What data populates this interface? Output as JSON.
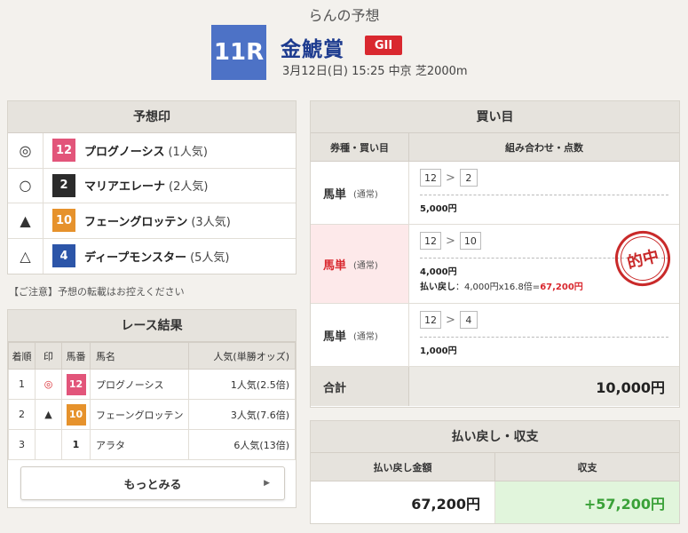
{
  "header": {
    "title": "らんの予想",
    "race_no": "11R",
    "race_name": "金鯱賞",
    "grade": "GII",
    "info": "3月12日(日) 15:25 中京 芝2000m"
  },
  "prediction": {
    "heading": "予想印",
    "items": [
      {
        "mark": "◎",
        "num": "12",
        "name": "プログノーシス",
        "pop": "(1人気)",
        "color": "#e2557a"
      },
      {
        "mark": "○",
        "num": "2",
        "name": "マリアエレーナ",
        "pop": "(2人気)",
        "color": "#2b2b2b"
      },
      {
        "mark": "▲",
        "num": "10",
        "name": "フェーングロッテン",
        "pop": "(3人気)",
        "color": "#e6922c"
      },
      {
        "mark": "△",
        "num": "4",
        "name": "ディープモンスター",
        "pop": "(5人気)",
        "color": "#2c55a8"
      }
    ],
    "note": "【ご注意】予想の転載はお控えください"
  },
  "result": {
    "heading": "レース結果",
    "columns": [
      "着順",
      "印",
      "馬番",
      "馬名",
      "人気(単勝オッズ)"
    ],
    "rows": [
      {
        "rank": "1",
        "mark": "◎",
        "num": "12",
        "name": "プログノーシス",
        "pop": "1人気(2.5倍)",
        "color": "#e2557a",
        "text_color": "#ffffff"
      },
      {
        "rank": "2",
        "mark": "▲",
        "num": "10",
        "name": "フェーングロッテン",
        "pop": "3人気(7.6倍)",
        "color": "#e6922c",
        "text_color": "#ffffff"
      },
      {
        "rank": "3",
        "mark": "",
        "num": "1",
        "name": "アラタ",
        "pop": "6人気(13倍)",
        "color": "#ffffff",
        "text_color": "#222222"
      }
    ],
    "more_label": "もっとみる",
    "more_arrow": "▶"
  },
  "bets": {
    "heading": "買い目",
    "col_type": "券種・買い目",
    "col_combo": "組み合わせ・点数",
    "rows": [
      {
        "type": "馬単",
        "sub": "(通常)",
        "first": "12",
        "second": "2",
        "amount": "5,000円",
        "hit": false
      },
      {
        "type": "馬単",
        "sub": "(通常)",
        "first": "12",
        "second": "10",
        "amount": "4,000円",
        "hit": true,
        "payout_label": "払い戻し",
        "payout_calc": "：4,000円x16.8倍=",
        "payout_result": "67,200円",
        "stamp": "的中"
      },
      {
        "type": "馬単",
        "sub": "(通常)",
        "first": "12",
        "second": "4",
        "amount": "1,000円",
        "hit": false
      }
    ],
    "gt_symbol": ">",
    "total_label": "合計",
    "total_value": "10,000円"
  },
  "payout": {
    "heading": "払い戻し・収支",
    "col_payout": "払い戻し金額",
    "col_balance": "収支",
    "payout_value": "67,200円",
    "balance_value": "+57,200円"
  }
}
